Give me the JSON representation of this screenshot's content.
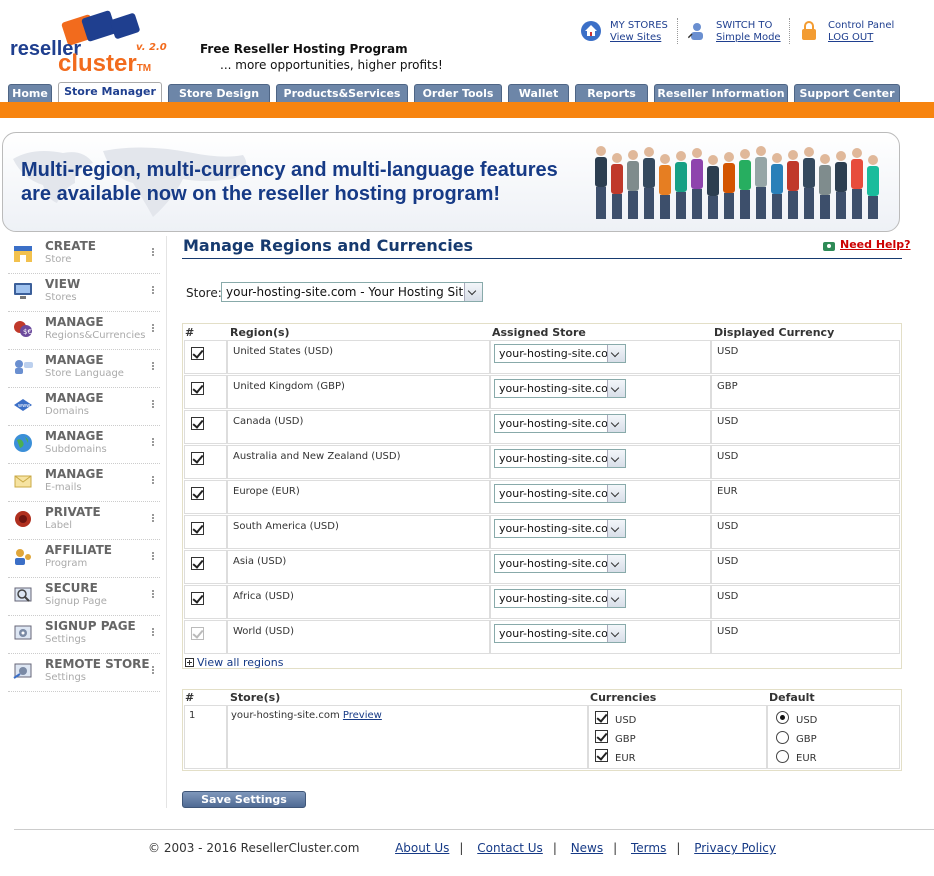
{
  "header": {
    "logo_word1": "reseller",
    "logo_word2": "cluster",
    "logo_tm": "TM",
    "logo_version": "v. 2.0",
    "tagline": "Free Reseller Hosting Program",
    "tagline_sub": "... more opportunities, higher profits!",
    "links": [
      {
        "title": "MY STORES",
        "action": "View Sites",
        "icon": "house-icon"
      },
      {
        "title": "SWITCH TO",
        "action": "Simple Mode",
        "icon": "user-switch-icon"
      },
      {
        "title": "Control Panel",
        "action": "LOG OUT",
        "icon": "lock-icon"
      }
    ]
  },
  "nav": {
    "tabs": [
      "Home",
      "Store Manager",
      "Store Design",
      "Products&Services",
      "Order Tools",
      "Wallet",
      "Reports",
      "Reseller Information",
      "Support Center"
    ],
    "active": "Store Manager"
  },
  "banner": {
    "line1": "Multi-region, multi-currency and multi-language features",
    "line2": "are available now on the reseller hosting program!"
  },
  "sidebar": {
    "items": [
      {
        "title": "CREATE",
        "sub": "Store",
        "icon": "create-store-icon"
      },
      {
        "title": "VIEW",
        "sub": "Stores",
        "icon": "monitor-icon"
      },
      {
        "title": "MANAGE",
        "sub": "Regions&Currencies",
        "icon": "currency-icon"
      },
      {
        "title": "MANAGE",
        "sub": "Store Language",
        "icon": "language-icon"
      },
      {
        "title": "MANAGE",
        "sub": "Domains",
        "icon": "domain-icon"
      },
      {
        "title": "MANAGE",
        "sub": "Subdomains",
        "icon": "globe-icon"
      },
      {
        "title": "MANAGE",
        "sub": "E-mails",
        "icon": "envelope-icon"
      },
      {
        "title": "PRIVATE",
        "sub": "Label",
        "icon": "label-icon"
      },
      {
        "title": "AFFILIATE",
        "sub": "Program",
        "icon": "affiliate-icon"
      },
      {
        "title": "SECURE",
        "sub": "Signup Page",
        "icon": "secure-icon"
      },
      {
        "title": "SIGNUP PAGE",
        "sub": "Settings",
        "icon": "signup-settings-icon"
      },
      {
        "title": "REMOTE STORE",
        "sub": "Settings",
        "icon": "remote-store-icon"
      }
    ]
  },
  "main": {
    "title": "Manage Regions and Currencies",
    "help": "Need Help?",
    "store_label": "Store:",
    "store_value": "your-hosting-site.com - Your Hosting Site",
    "regions_table": {
      "headers": [
        "#",
        "Region(s)",
        "Assigned Store",
        "Displayed Currency"
      ],
      "rows": [
        {
          "region": "United States (USD)",
          "store": "your-hosting-site.com",
          "currency": "USD",
          "checked": true,
          "disabled": false
        },
        {
          "region": "United Kingdom (GBP)",
          "store": "your-hosting-site.com",
          "currency": "GBP",
          "checked": true,
          "disabled": false
        },
        {
          "region": "Canada (USD)",
          "store": "your-hosting-site.com",
          "currency": "USD",
          "checked": true,
          "disabled": false
        },
        {
          "region": "Australia and New Zealand (USD)",
          "store": "your-hosting-site.com",
          "currency": "USD",
          "checked": true,
          "disabled": false
        },
        {
          "region": "Europe (EUR)",
          "store": "your-hosting-site.com",
          "currency": "EUR",
          "checked": true,
          "disabled": false
        },
        {
          "region": "South America (USD)",
          "store": "your-hosting-site.com",
          "currency": "USD",
          "checked": true,
          "disabled": false
        },
        {
          "region": "Asia (USD)",
          "store": "your-hosting-site.com",
          "currency": "USD",
          "checked": true,
          "disabled": false
        },
        {
          "region": "Africa (USD)",
          "store": "your-hosting-site.com",
          "currency": "USD",
          "checked": true,
          "disabled": false
        },
        {
          "region": "World (USD)",
          "store": "your-hosting-site.com",
          "currency": "USD",
          "checked": true,
          "disabled": true
        }
      ],
      "view_all": "View all regions"
    },
    "stores_table": {
      "headers": [
        "#",
        "Store(s)",
        "Currencies",
        "Default"
      ],
      "row": {
        "num": "1",
        "store": "your-hosting-site.com",
        "preview": "Preview",
        "currencies": [
          "USD",
          "GBP",
          "EUR"
        ],
        "default": "USD"
      }
    },
    "save_label": "Save Settings"
  },
  "footer": {
    "copyright": "© 2003 - 2016 ResellerCluster.com",
    "links": [
      "About Us",
      "Contact Us",
      "News",
      "Terms",
      "Privacy Policy"
    ]
  },
  "colors": {
    "orange": "#f7840f",
    "navy": "#163a86",
    "tab": "#6d86a8"
  }
}
